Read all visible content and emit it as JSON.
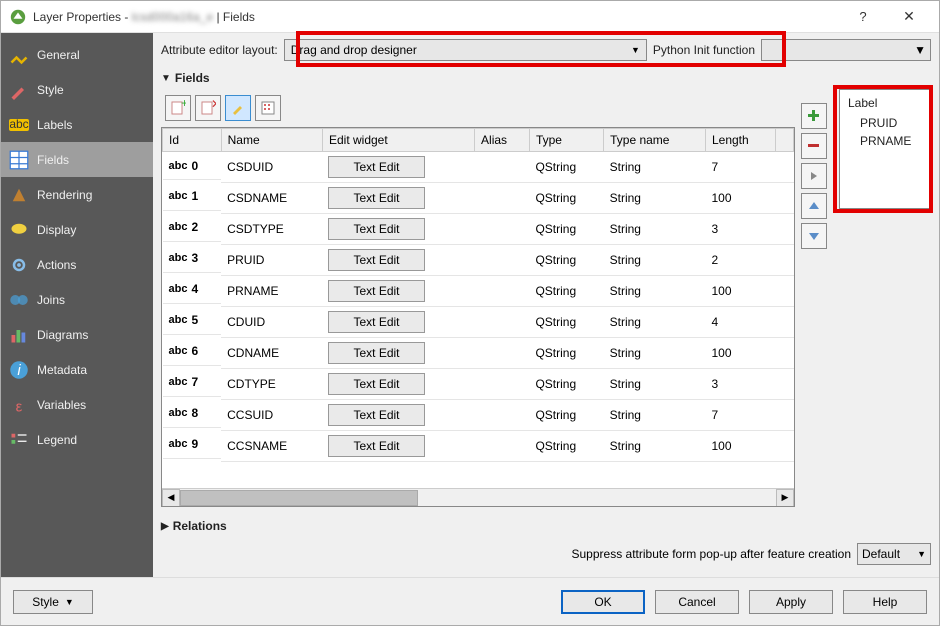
{
  "window": {
    "title_prefix": "Layer Properties - ",
    "title_layer": "lcsd000a16a_e",
    "title_suffix": " | Fields"
  },
  "sidebar": {
    "items": [
      {
        "label": "General"
      },
      {
        "label": "Style"
      },
      {
        "label": "Labels"
      },
      {
        "label": "Fields"
      },
      {
        "label": "Rendering"
      },
      {
        "label": "Display"
      },
      {
        "label": "Actions"
      },
      {
        "label": "Joins"
      },
      {
        "label": "Diagrams"
      },
      {
        "label": "Metadata"
      },
      {
        "label": "Variables"
      },
      {
        "label": "Legend"
      }
    ]
  },
  "toprow": {
    "label_attr_editor": "Attribute editor layout:",
    "combo_value": "Drag and drop designer",
    "label_py": "Python Init function",
    "py_value": ""
  },
  "sections": {
    "fields": "Fields",
    "relations": "Relations"
  },
  "table": {
    "headers": [
      "Id",
      "Name",
      "Edit widget",
      "Alias",
      "Type",
      "Type name",
      "Length"
    ],
    "rows": [
      {
        "id": "0",
        "name": "CSDUID",
        "widget": "Text Edit",
        "alias": "",
        "type": "QString",
        "typename": "String",
        "length": "7"
      },
      {
        "id": "1",
        "name": "CSDNAME",
        "widget": "Text Edit",
        "alias": "",
        "type": "QString",
        "typename": "String",
        "length": "100"
      },
      {
        "id": "2",
        "name": "CSDTYPE",
        "widget": "Text Edit",
        "alias": "",
        "type": "QString",
        "typename": "String",
        "length": "3"
      },
      {
        "id": "3",
        "name": "PRUID",
        "widget": "Text Edit",
        "alias": "",
        "type": "QString",
        "typename": "String",
        "length": "2"
      },
      {
        "id": "4",
        "name": "PRNAME",
        "widget": "Text Edit",
        "alias": "",
        "type": "QString",
        "typename": "String",
        "length": "100"
      },
      {
        "id": "5",
        "name": "CDUID",
        "widget": "Text Edit",
        "alias": "",
        "type": "QString",
        "typename": "String",
        "length": "4"
      },
      {
        "id": "6",
        "name": "CDNAME",
        "widget": "Text Edit",
        "alias": "",
        "type": "QString",
        "typename": "String",
        "length": "100"
      },
      {
        "id": "7",
        "name": "CDTYPE",
        "widget": "Text Edit",
        "alias": "",
        "type": "QString",
        "typename": "String",
        "length": "3"
      },
      {
        "id": "8",
        "name": "CCSUID",
        "widget": "Text Edit",
        "alias": "",
        "type": "QString",
        "typename": "String",
        "length": "7"
      },
      {
        "id": "9",
        "name": "CCSNAME",
        "widget": "Text Edit",
        "alias": "",
        "type": "QString",
        "typename": "String",
        "length": "100"
      }
    ]
  },
  "label_panel": {
    "header": "Label",
    "items": [
      "PRUID",
      "PRNAME"
    ]
  },
  "suppress": {
    "label": "Suppress attribute form pop-up after feature creation",
    "value": "Default"
  },
  "footer": {
    "style": "Style",
    "ok": "OK",
    "cancel": "Cancel",
    "apply": "Apply",
    "help": "Help"
  }
}
